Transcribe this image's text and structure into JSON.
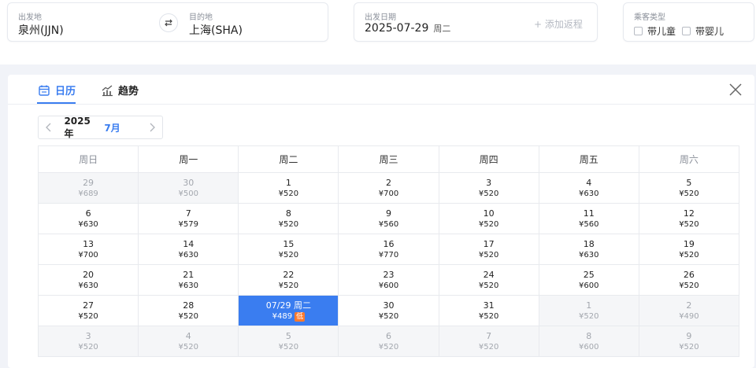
{
  "search": {
    "from_label": "出发地",
    "from_value": "泉州(JJN)",
    "to_label": "目的地",
    "to_value": "上海(SHA)",
    "date_label": "出发日期",
    "date_value": "2025-07-29",
    "date_weekday": "周二",
    "add_return": "+ 添加返程",
    "pax_label": "乘客类型",
    "with_child": "带儿童",
    "with_infant": "带婴儿"
  },
  "tabs": {
    "calendar": "日历",
    "trend": "趋势"
  },
  "month_nav": {
    "year": "2025年",
    "month": "7月"
  },
  "colors": {
    "accent": "#3a7df0",
    "low_badge": "#ff7a2e",
    "other_month_bg": "#f5f6f8"
  },
  "weekdays": [
    "周日",
    "周一",
    "周二",
    "周三",
    "周四",
    "周五",
    "周六"
  ],
  "weeks": [
    [
      {
        "day": "29",
        "price": "¥689",
        "other": true
      },
      {
        "day": "30",
        "price": "¥500",
        "other": true
      },
      {
        "day": "1",
        "price": "¥520"
      },
      {
        "day": "2",
        "price": "¥700"
      },
      {
        "day": "3",
        "price": "¥520"
      },
      {
        "day": "4",
        "price": "¥630"
      },
      {
        "day": "5",
        "price": "¥520"
      }
    ],
    [
      {
        "day": "6",
        "price": "¥630"
      },
      {
        "day": "7",
        "price": "¥579"
      },
      {
        "day": "8",
        "price": "¥520"
      },
      {
        "day": "9",
        "price": "¥560"
      },
      {
        "day": "10",
        "price": "¥520"
      },
      {
        "day": "11",
        "price": "¥560"
      },
      {
        "day": "12",
        "price": "¥520"
      }
    ],
    [
      {
        "day": "13",
        "price": "¥700"
      },
      {
        "day": "14",
        "price": "¥630"
      },
      {
        "day": "15",
        "price": "¥520"
      },
      {
        "day": "16",
        "price": "¥770"
      },
      {
        "day": "17",
        "price": "¥520"
      },
      {
        "day": "18",
        "price": "¥630"
      },
      {
        "day": "19",
        "price": "¥520"
      }
    ],
    [
      {
        "day": "20",
        "price": "¥630"
      },
      {
        "day": "21",
        "price": "¥630"
      },
      {
        "day": "22",
        "price": "¥520"
      },
      {
        "day": "23",
        "price": "¥600"
      },
      {
        "day": "24",
        "price": "¥520"
      },
      {
        "day": "25",
        "price": "¥600"
      },
      {
        "day": "26",
        "price": "¥520"
      }
    ],
    [
      {
        "day": "27",
        "price": "¥520"
      },
      {
        "day": "28",
        "price": "¥520"
      },
      {
        "day": "07/29 周二",
        "price": "¥489",
        "selected": true,
        "badge": "低"
      },
      {
        "day": "30",
        "price": "¥520"
      },
      {
        "day": "31",
        "price": "¥520"
      },
      {
        "day": "1",
        "price": "¥520",
        "other": true
      },
      {
        "day": "2",
        "price": "¥490",
        "other": true
      }
    ],
    [
      {
        "day": "3",
        "price": "¥520",
        "other": true
      },
      {
        "day": "4",
        "price": "¥520",
        "other": true
      },
      {
        "day": "5",
        "price": "¥520",
        "other": true
      },
      {
        "day": "6",
        "price": "¥520",
        "other": true
      },
      {
        "day": "7",
        "price": "¥520",
        "other": true
      },
      {
        "day": "8",
        "price": "¥600",
        "other": true
      },
      {
        "day": "9",
        "price": "¥520",
        "other": true
      }
    ]
  ]
}
